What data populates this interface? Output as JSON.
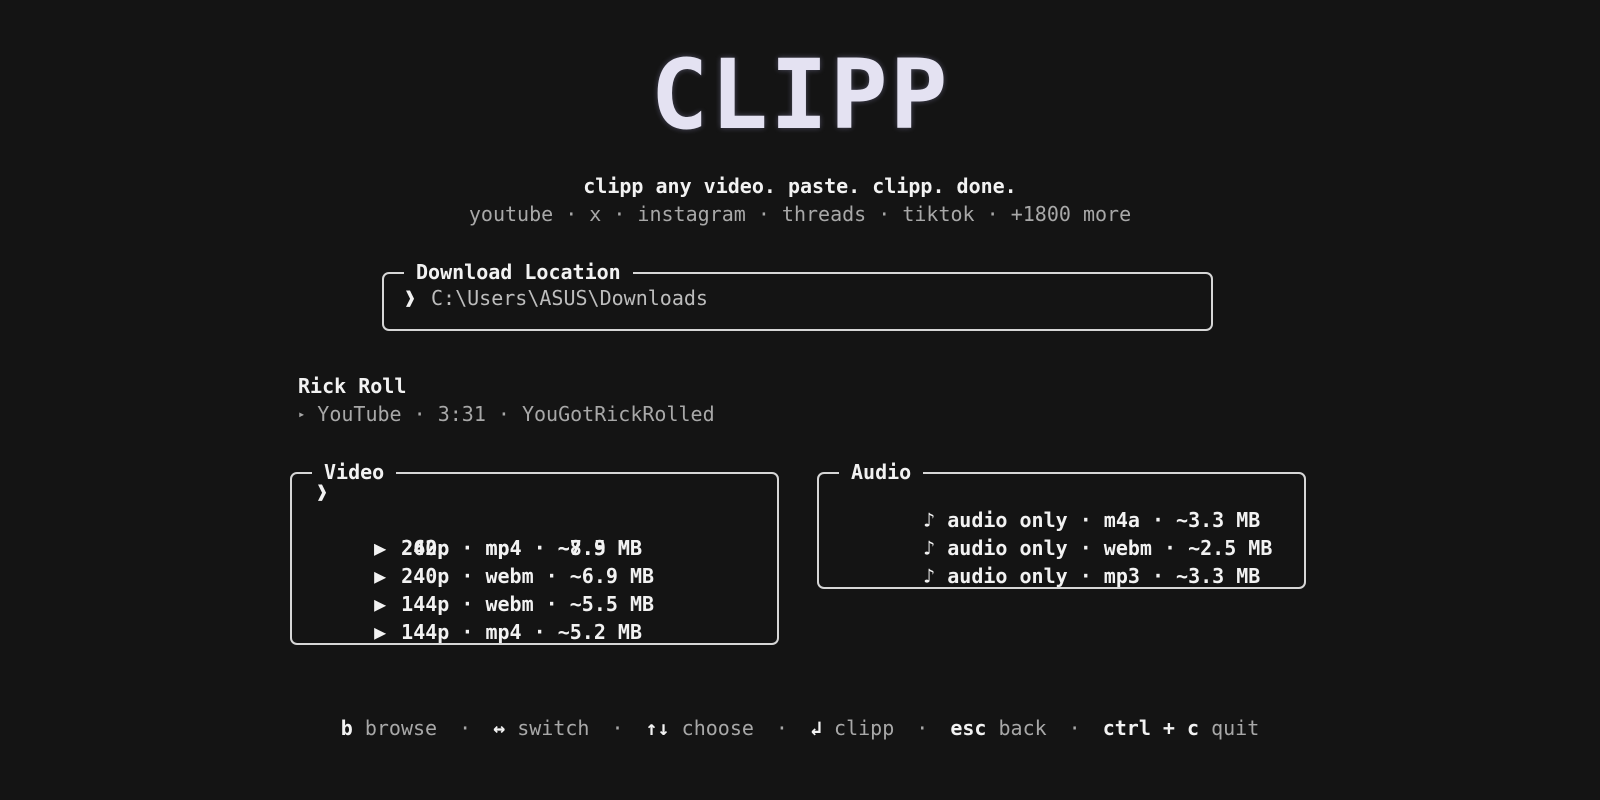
{
  "logo": {
    "text": "CLIPP"
  },
  "tagline": "clipp any video. paste. clipp. done.",
  "platforms": "youtube · x · instagram · threads · tiktok · +1800 more",
  "download_location": {
    "title": "Download Location",
    "prompt": "❱",
    "path": "C:\\Users\\ASUS\\Downloads"
  },
  "media": {
    "title": "Rick Roll",
    "icon": "play-triangle-icon",
    "meta_icon_glyph": "▸",
    "meta": "YouTube · 3:31 · YouGotRickRolled"
  },
  "video": {
    "title": "Video",
    "selected_marker": "❱",
    "items": [
      {
        "icon": "▶",
        "label": "262p · mp4 · ~8.9 MB",
        "selected": true
      },
      {
        "icon": "▶",
        "label": "240p · mp4 · ~7.5 MB",
        "selected": false
      },
      {
        "icon": "▶",
        "label": "240p · webm · ~6.9 MB",
        "selected": false
      },
      {
        "icon": "▶",
        "label": "144p · webm · ~5.5 MB",
        "selected": false
      },
      {
        "icon": "▶",
        "label": "144p · mp4 · ~5.2 MB",
        "selected": false
      }
    ]
  },
  "audio": {
    "title": "Audio",
    "items": [
      {
        "icon": "♪",
        "label": "audio only · m4a · ~3.3 MB"
      },
      {
        "icon": "♪",
        "label": "audio only · webm · ~2.5 MB"
      },
      {
        "icon": "♪",
        "label": "audio only · mp3 · ~3.3 MB"
      }
    ]
  },
  "footer": {
    "separator": "·",
    "hints": [
      {
        "key": "b",
        "action": "browse"
      },
      {
        "key": "↔",
        "action": "switch"
      },
      {
        "key": "↑↓",
        "action": "choose"
      },
      {
        "key": "↲",
        "action": "clipp"
      },
      {
        "key": "esc",
        "action": "back"
      },
      {
        "key": "ctrl + c",
        "action": "quit"
      }
    ]
  },
  "colors": {
    "background": "#141414",
    "text": "#f2f2f2",
    "muted": "#a8a8a8",
    "border": "#d6d6d6",
    "logo": "#e4e2f2"
  }
}
